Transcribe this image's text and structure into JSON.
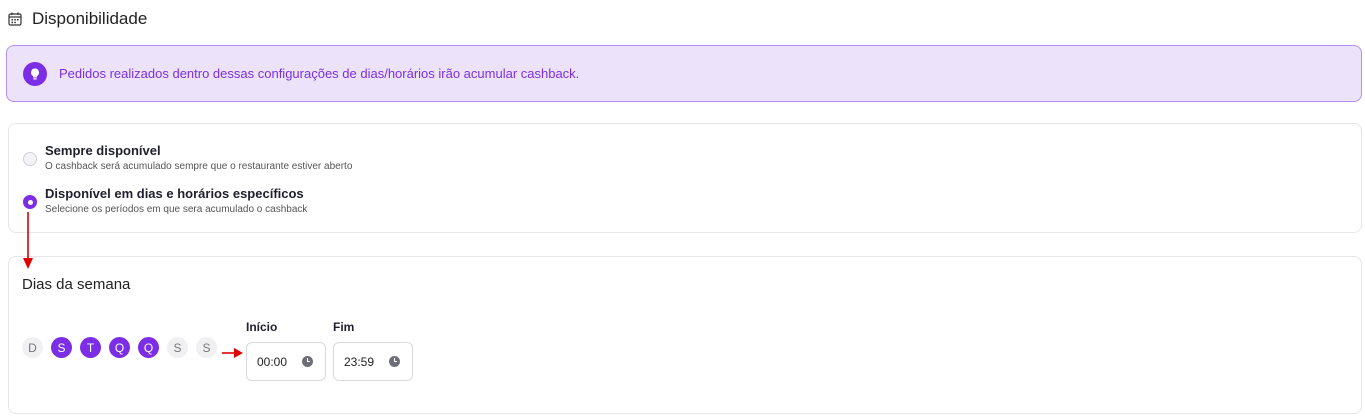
{
  "header": {
    "title": "Disponibilidade",
    "icon": "calendar-icon"
  },
  "alert": {
    "message": "Pedidos realizados dentro dessas configurações de dias/horários irão acumular cashback.",
    "icon": "lightbulb-icon",
    "accent": "#7c2ee6"
  },
  "availability": {
    "options": [
      {
        "title": "Sempre disponível",
        "description": "O cashback será acumulado sempre que o restaurante estiver aberto",
        "selected": false
      },
      {
        "title": "Disponível em dias e horários específicos",
        "description": "Selecione os períodos em que sera acumulado o cashback",
        "selected": true
      }
    ]
  },
  "weekdays": {
    "title": "Dias da semana",
    "days": [
      {
        "label": "D",
        "active": false
      },
      {
        "label": "S",
        "active": true
      },
      {
        "label": "T",
        "active": true
      },
      {
        "label": "Q",
        "active": true
      },
      {
        "label": "Q",
        "active": true
      },
      {
        "label": "S",
        "active": false
      },
      {
        "label": "S",
        "active": false
      }
    ]
  },
  "time": {
    "start_label": "Início",
    "start_value": "00:00",
    "end_label": "Fim",
    "end_value": "23:59"
  },
  "colors": {
    "accent": "#7c2ee6",
    "annotation_arrow": "#e00000"
  }
}
